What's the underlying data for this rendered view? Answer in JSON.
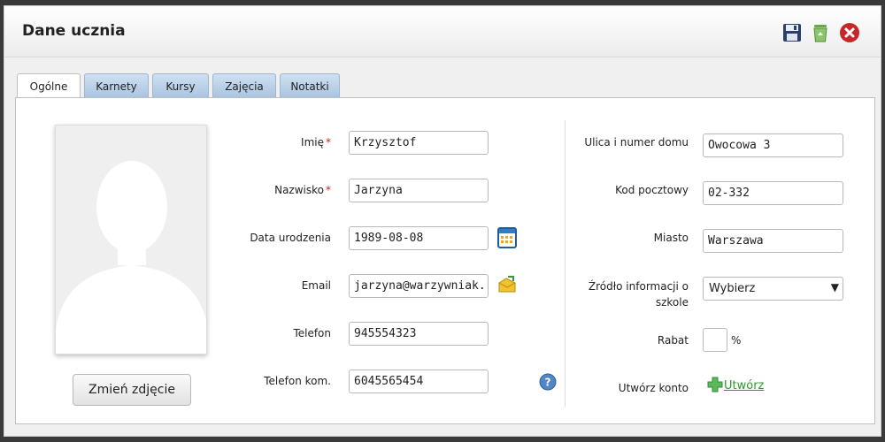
{
  "dialog": {
    "title": "Dane ucznia",
    "tools": {
      "save": "save-icon",
      "delete": "trash-icon",
      "close": "close-icon"
    }
  },
  "tabs": [
    {
      "label": "Ogólne",
      "active": true
    },
    {
      "label": "Karnety",
      "active": false
    },
    {
      "label": "Kursy",
      "active": false
    },
    {
      "label": "Zajęcia",
      "active": false
    },
    {
      "label": "Notatki",
      "active": false
    }
  ],
  "photo": {
    "button_label": "Zmień zdjęcie"
  },
  "left_form": {
    "first_name": {
      "label": "Imię",
      "required": "*",
      "value": "Krzysztof"
    },
    "last_name": {
      "label": "Nazwisko",
      "required": "*",
      "value": "Jarzyna"
    },
    "birth_date": {
      "label": "Data urodzenia",
      "value": "1989-08-08"
    },
    "email": {
      "label": "Email",
      "value": "jarzyna@warzywniak.pl"
    },
    "phone": {
      "label": "Telefon",
      "value": "945554323"
    },
    "mobile": {
      "label": "Telefon kom.",
      "value": "6045565454"
    }
  },
  "right_form": {
    "street": {
      "label": "Ulica i numer domu",
      "value": "Owocowa 3"
    },
    "postal": {
      "label": "Kod pocztowy",
      "value": "02-332"
    },
    "city": {
      "label": "Miasto",
      "value": "Warszawa"
    },
    "source": {
      "label_line1": "Źródło informacji o",
      "label_line2": "szkole",
      "value": "Wybierz"
    },
    "discount": {
      "label": "Rabat",
      "value": "",
      "unit": "%"
    },
    "account": {
      "label": "Utwórz konto",
      "link": "Utwórz"
    }
  },
  "colors": {
    "tab_inactive": "#a9c3de",
    "link": "#2a9a2a",
    "required": "#d02020",
    "close": "#c62828"
  }
}
